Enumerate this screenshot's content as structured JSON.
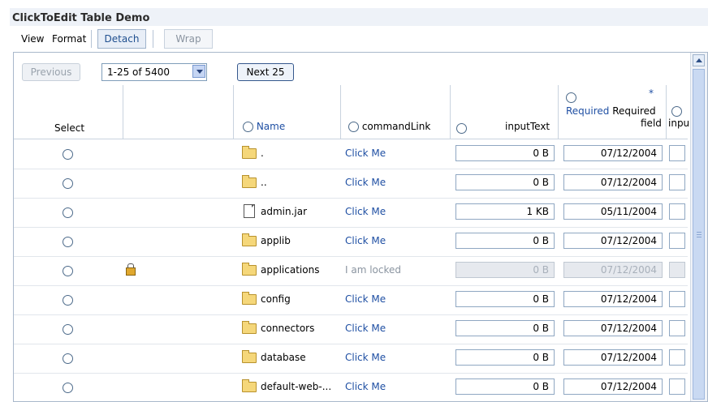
{
  "title": "ClickToEdit Table Demo",
  "toolbar": {
    "view": "View",
    "format": "Format",
    "detach": "Detach",
    "wrap": "Wrap"
  },
  "nav": {
    "previous": "Previous",
    "range": "1-25 of 5400",
    "next": "Next 25"
  },
  "headers": {
    "select": "Select",
    "name": "Name",
    "command_link": "commandLink",
    "input_text": "inputText",
    "required_star": "*",
    "required_link": "Required",
    "required_text1": "Required",
    "required_text2": "field",
    "last": "inpu"
  },
  "rows": [
    {
      "icon": "folder-icon",
      "name": ".",
      "link": "Click Me",
      "size": "0 B",
      "date": "07/12/2004",
      "locked": false
    },
    {
      "icon": "folder-icon",
      "name": "..",
      "link": "Click Me",
      "size": "0 B",
      "date": "07/12/2004",
      "locked": false
    },
    {
      "icon": "file-icon",
      "name": "admin.jar",
      "link": "Click Me",
      "size": "1 KB",
      "date": "05/11/2004",
      "locked": false
    },
    {
      "icon": "folder-icon",
      "name": "applib",
      "link": "Click Me",
      "size": "0 B",
      "date": "07/12/2004",
      "locked": false
    },
    {
      "icon": "folder-icon",
      "name": "applications",
      "link": "I am locked",
      "size": "0 B",
      "date": "07/12/2004",
      "locked": true
    },
    {
      "icon": "folder-icon",
      "name": "config",
      "link": "Click Me",
      "size": "0 B",
      "date": "07/12/2004",
      "locked": false
    },
    {
      "icon": "folder-icon",
      "name": "connectors",
      "link": "Click Me",
      "size": "0 B",
      "date": "07/12/2004",
      "locked": false
    },
    {
      "icon": "folder-icon",
      "name": "database",
      "link": "Click Me",
      "size": "0 B",
      "date": "07/12/2004",
      "locked": false
    },
    {
      "icon": "folder-icon",
      "name": "default-web-...",
      "link": "Click Me",
      "size": "0 B",
      "date": "07/12/2004",
      "locked": false
    }
  ],
  "colors": {
    "link": "#1f4fa3",
    "locked_text": "#8a94a0"
  }
}
